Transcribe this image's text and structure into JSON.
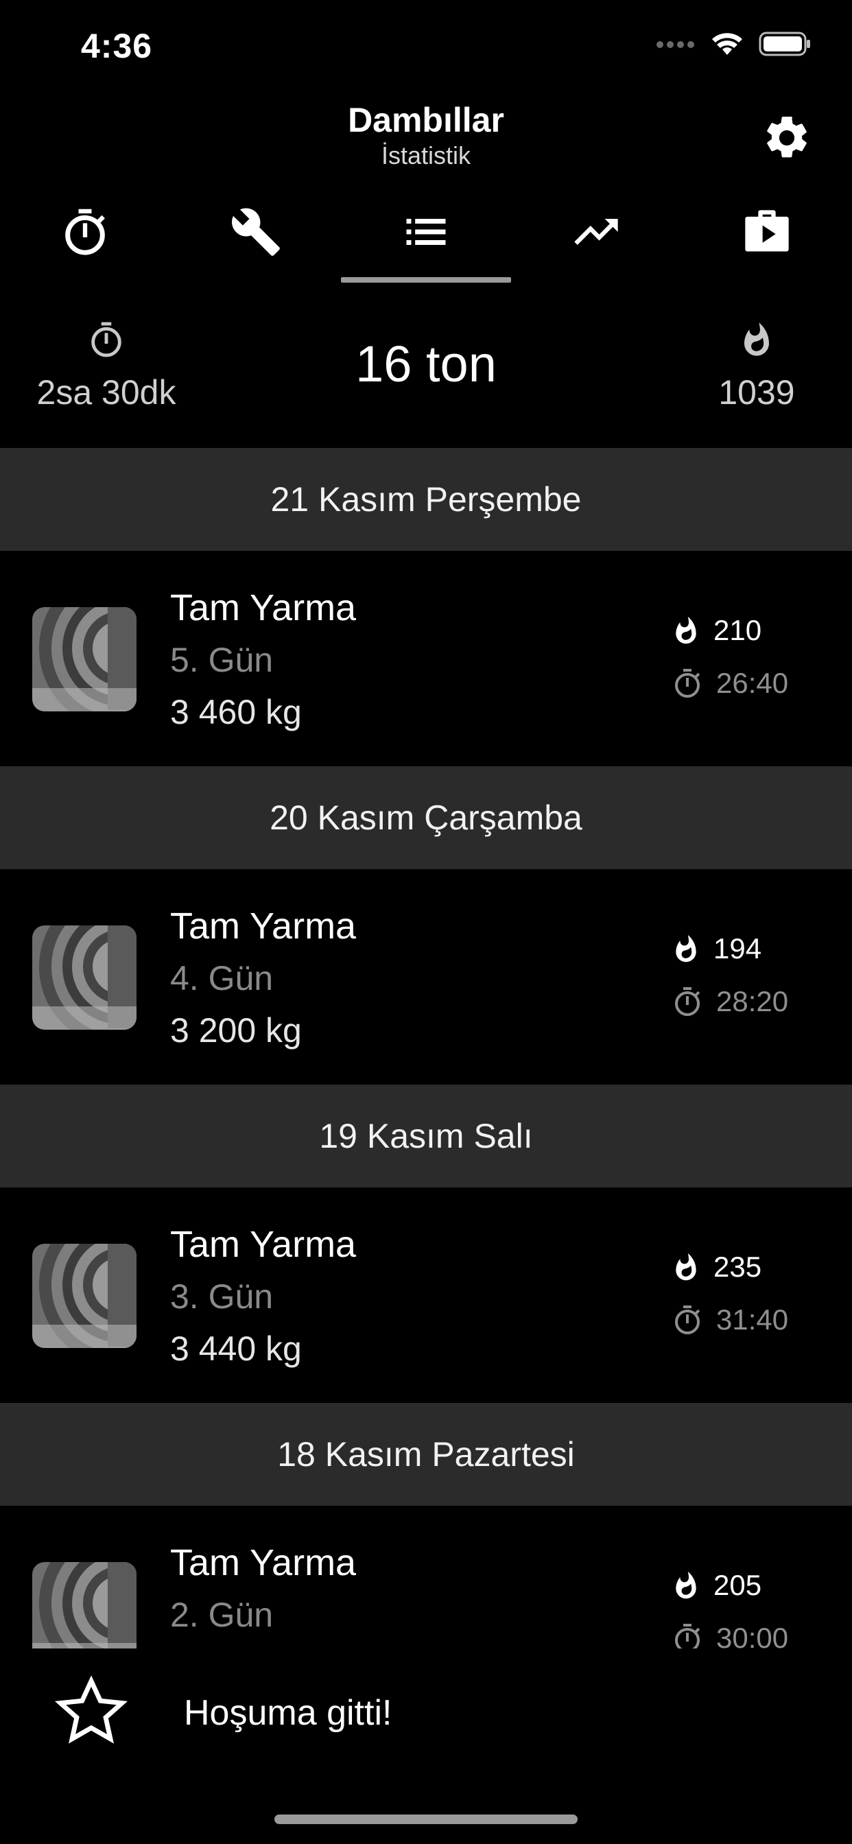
{
  "status_bar": {
    "time": "4:36"
  },
  "header": {
    "title": "Dambıllar",
    "subtitle": "İstatistik"
  },
  "tabs": [
    {
      "icon": "stopwatch-icon"
    },
    {
      "icon": "wrench-icon"
    },
    {
      "icon": "list-icon",
      "selected": true
    },
    {
      "icon": "trending-up-icon"
    },
    {
      "icon": "video-briefcase-icon"
    }
  ],
  "summary": {
    "duration": "2sa 30dk",
    "total_weight": "16 ton",
    "calories": "1039"
  },
  "sessions": [
    {
      "date": "21 Kasım Perşembe",
      "title": "Tam Yarma",
      "day": "5. Gün",
      "weight": "3 460 kg",
      "calories": "210",
      "duration": "26:40"
    },
    {
      "date": "20 Kasım Çarşamba",
      "title": "Tam Yarma",
      "day": "4. Gün",
      "weight": "3 200 kg",
      "calories": "194",
      "duration": "28:20"
    },
    {
      "date": "19 Kasım Salı",
      "title": "Tam Yarma",
      "day": "3. Gün",
      "weight": "3 440 kg",
      "calories": "235",
      "duration": "31:40"
    },
    {
      "date": "18 Kasım Pazartesi",
      "title": "Tam Yarma",
      "day": "2. Gün",
      "weight": "",
      "calories": "205",
      "duration": "30:00"
    }
  ],
  "bottom": {
    "like_label": "Hoşuma gitti!"
  },
  "colors": {
    "background": "#000000",
    "section_header": "#2b2b2b",
    "muted_text": "#8a8a8a"
  }
}
